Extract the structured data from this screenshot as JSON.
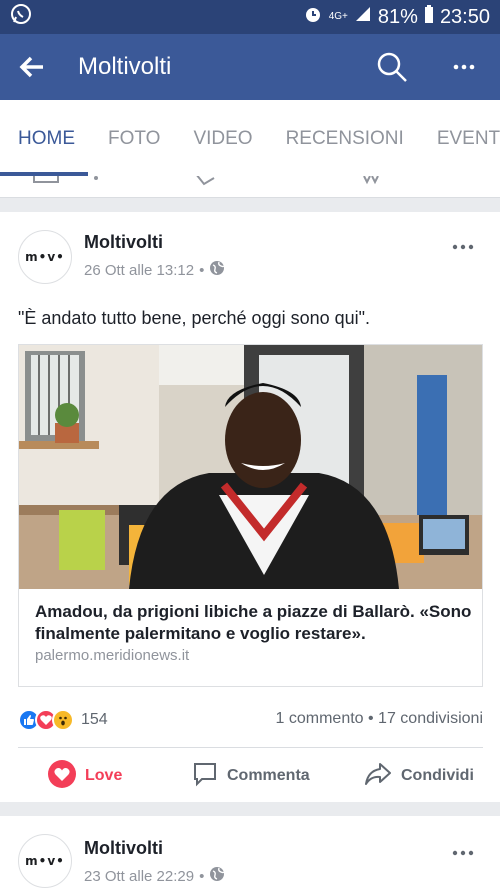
{
  "status_bar": {
    "network": "4G+",
    "battery": "81%",
    "time": "23:50",
    "icons": [
      "whatsapp-icon",
      "alarm-icon",
      "signal-icon",
      "battery-icon"
    ]
  },
  "app_bar": {
    "title": "Moltivolti",
    "icons": [
      "back-arrow-icon",
      "search-icon",
      "more-icon"
    ]
  },
  "tabs": [
    {
      "label": "HOME",
      "active": true
    },
    {
      "label": "FOTO",
      "active": false
    },
    {
      "label": "VIDEO",
      "active": false
    },
    {
      "label": "RECENSIONI",
      "active": false
    },
    {
      "label": "EVENTI",
      "active": false
    }
  ],
  "posts": [
    {
      "author": "Moltivolti",
      "avatar_text": "m•v•",
      "date": "26 Ott alle 13:12",
      "privacy_icon": "globe-icon",
      "text": "\"È andato tutto bene, perché oggi sono qui\".",
      "link": {
        "title": "Amadou, da prigioni libiche a piazze di Ballarò. «Sono finalmente palermitano e voglio restare».",
        "domain": "palermo.meridionews.it",
        "image": "photo of a smiling young man in a black puffer jacket inside a café"
      },
      "reactions": [
        "like-icon",
        "love-icon",
        "wow-icon"
      ],
      "reaction_count": "154",
      "comments_shares": "1 commento • 17 condivisioni",
      "actions": {
        "love": "Love",
        "comment": "Commenta",
        "share": "Condividi"
      }
    },
    {
      "author": "Moltivolti",
      "avatar_text": "m•v•",
      "date": "23 Ott alle 22:29",
      "privacy_icon": "globe-icon"
    }
  ],
  "colors": {
    "brand": "#3b5998",
    "status_bar": "#2b4377",
    "love": "#f33e58"
  }
}
